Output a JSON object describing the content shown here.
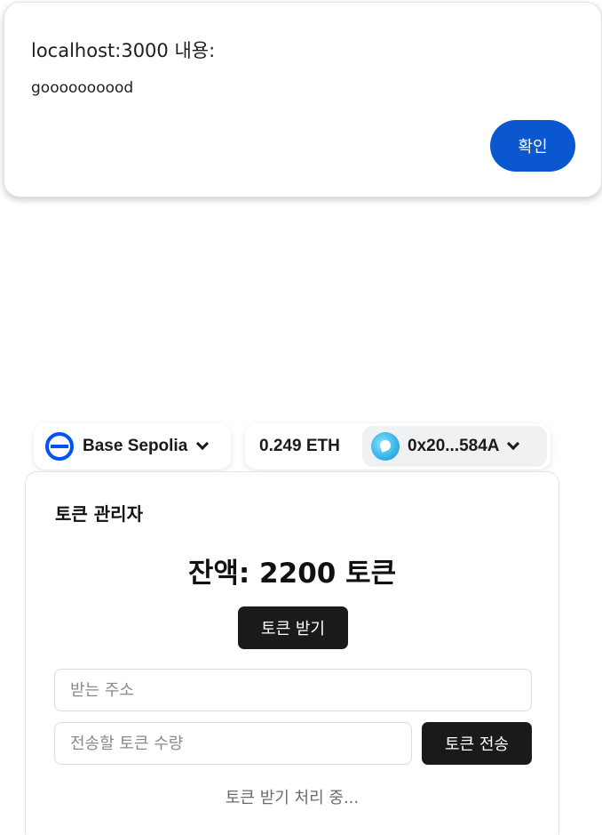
{
  "dialog": {
    "title": "localhost:3000 내용:",
    "message": "goooooooood",
    "ok_label": "확인",
    "ok_color": "#0b57d0"
  },
  "wallet": {
    "chain": {
      "name": "Base Sepolia",
      "icon": "base-logo-icon",
      "brand_color": "#0052ff"
    },
    "balance": "0.249 ETH",
    "address": "0x20...584A",
    "avatar_icon": "dolphin-avatar-icon"
  },
  "token_manager": {
    "title": "토큰 관리자",
    "balance_text": "잔액: 2200 토큰",
    "claim_label": "토큰 받기",
    "recipient_placeholder": "받는 주소",
    "amount_placeholder": "전송할 토큰 수량",
    "send_label": "토큰 전송",
    "status_text": "토큰 받기 처리 중..."
  }
}
